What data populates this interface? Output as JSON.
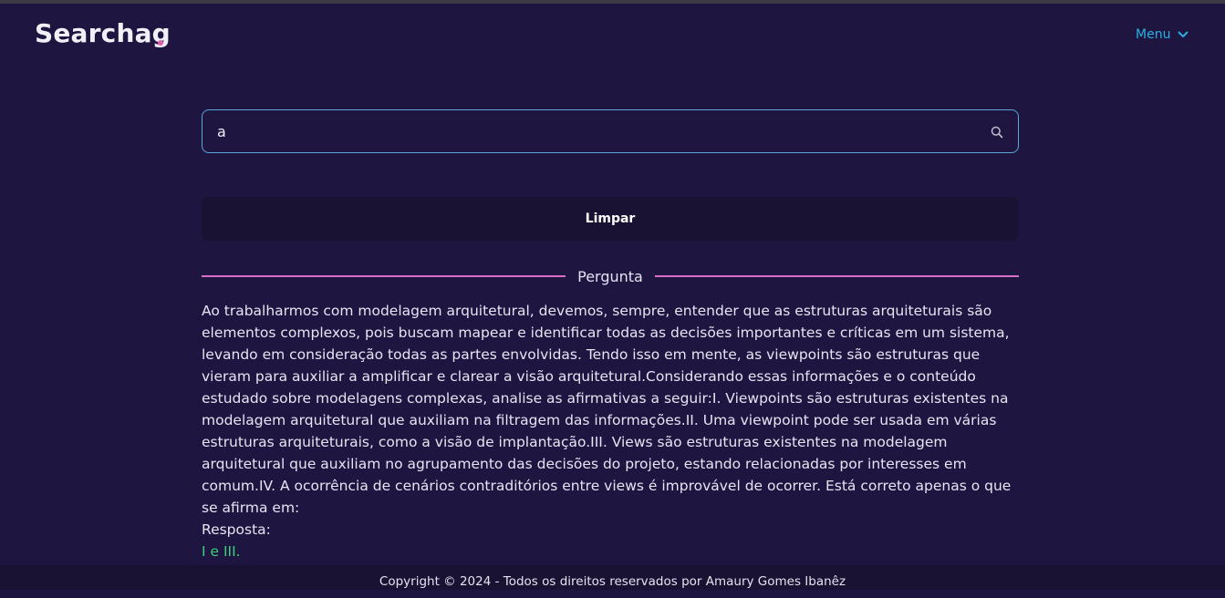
{
  "header": {
    "logo_text": "Searchag",
    "menu_label": "Menu",
    "menu_icon": "chevron-down-icon",
    "accent_color": "#2bb0e4",
    "logo_dot_color": "#e25db0"
  },
  "search": {
    "value": "a",
    "placeholder": "",
    "icon": "search-icon"
  },
  "actions": {
    "clear_label": "Limpar"
  },
  "section": {
    "title": "Pergunta",
    "divider_color": "#d86ec6"
  },
  "question": {
    "text": "Ao trabalharmos com modelagem arquitetural, devemos, sempre, entender que as estruturas arquiteturais são elementos complexos, pois buscam mapear e identificar todas as decisões importantes e críticas em um sistema, levando em consideração todas as partes envolvidas. Tendo isso em mente, as viewpoints são estruturas que vieram para auxiliar a amplificar e clarear a visão arquitetural.Considerando essas informações e o conteúdo estudado sobre modelagens complexas, analise as afirmativas a seguir:I. Viewpoints são estruturas existentes na modelagem arquitetural que auxiliam na filtragem das informações.II. Uma viewpoint pode ser usada em várias estruturas arquiteturais, como a visão de implantação.III. Views são estruturas existentes na modelagem arquitetural que auxiliam no agrupamento das decisões do projeto, estando relacionadas por interesses em comum.IV. A ocorrência de cenários contraditórios entre views é improvável de ocorrer. Está correto apenas o que se afirma em:"
  },
  "answer": {
    "label": "Resposta:",
    "value": "I e III.",
    "color": "#3fcf7a"
  },
  "footer": {
    "text": "Copyright © 2024 - Todos os direitos reservados por Amaury Gomes Ibanêz"
  }
}
